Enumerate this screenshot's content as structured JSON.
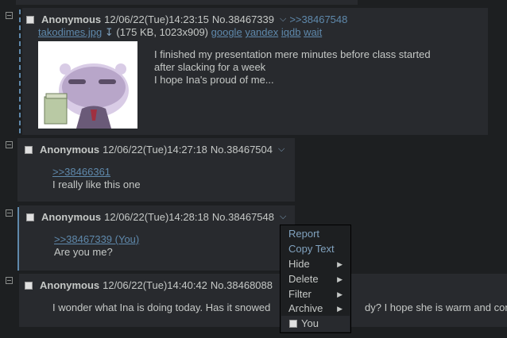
{
  "posts": [
    {
      "name": "Anonymous",
      "datetime": "12/06/22(Tue)14:23:15",
      "number": "No.38467339",
      "reply_link": ">>38467548",
      "file": {
        "name": "takodimes.jpg",
        "meta": "(175 KB, 1023x909)",
        "search": [
          "google",
          "yandex",
          "iqdb",
          "wait"
        ]
      },
      "lines": [
        "I finished my presentation mere minutes before class started",
        "after slacking for a week",
        "I hope Ina's proud of me..."
      ]
    },
    {
      "name": "Anonymous",
      "datetime": "12/06/22(Tue)14:27:18",
      "number": "No.38467504",
      "quote": ">>38466361",
      "lines": [
        "I really like this one"
      ]
    },
    {
      "name": "Anonymous",
      "datetime": "12/06/22(Tue)14:28:18",
      "number": "No.38467548",
      "quote": ">>38467339 (You)",
      "lines": [
        "Are you me?"
      ]
    },
    {
      "name": "Anonymous",
      "datetime": "12/06/22(Tue)14:40:42",
      "number": "No.38468088",
      "lines": [
        "I wonder what Ina is doing today. Has it snowed",
        "dy? I hope she is warm and com"
      ]
    }
  ],
  "menu": {
    "items": [
      "Report",
      "Copy Text",
      "Hide",
      "Delete",
      "Filter",
      "Archive"
    ],
    "you_label": "You"
  },
  "icons": {
    "chevron": "⌵",
    "download": "download-icon",
    "submenu": "▶"
  }
}
